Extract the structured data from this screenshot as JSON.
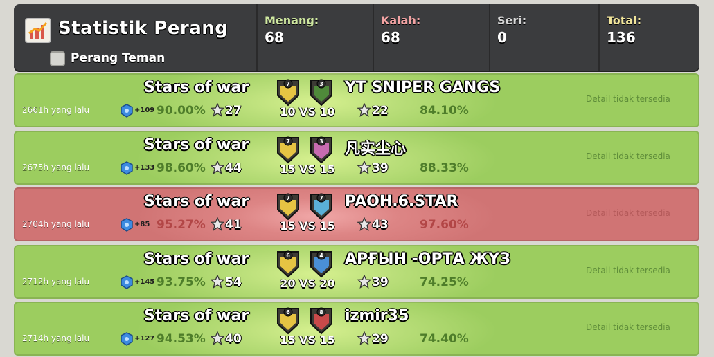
{
  "header": {
    "title": "Statistik Perang",
    "friendly_label": "Perang Teman",
    "stats": [
      {
        "label": "Menang:",
        "value": "68"
      },
      {
        "label": "Kalah:",
        "value": "68"
      },
      {
        "label": "Seri:",
        "value": "0"
      },
      {
        "label": "Total:",
        "value": "136"
      }
    ]
  },
  "colors": {
    "win_row": "#9ccd5f",
    "loss_row": "#d07474",
    "header_bg": "#3b3c3e",
    "win_label": "#cfe8a0",
    "loss_label": "#f2a3a3",
    "total_label": "#f1e59a"
  },
  "wars": [
    {
      "result": "win",
      "ago": "2661h yang lalu",
      "xp": "+109",
      "our_clan": "Stars of war",
      "our_level": "7",
      "our_destruction": "90.00%",
      "our_stars": "27",
      "opp_clan": "YT SNIPER GANGS",
      "opp_level": "3",
      "opp_destruction": "84.10%",
      "opp_stars": "22",
      "size": "10 VS 10",
      "detail": "Detail tidak tersedia"
    },
    {
      "result": "win",
      "ago": "2675h yang lalu",
      "xp": "+133",
      "our_clan": "Stars of war",
      "our_level": "7",
      "our_destruction": "98.60%",
      "our_stars": "44",
      "opp_clan": "凡实尘心",
      "opp_level": "3",
      "opp_destruction": "88.33%",
      "opp_stars": "39",
      "size": "15 VS 15",
      "detail": "Detail tidak tersedia"
    },
    {
      "result": "loss",
      "ago": "2704h yang lalu",
      "xp": "+85",
      "our_clan": "Stars of war",
      "our_level": "7",
      "our_destruction": "95.27%",
      "our_stars": "41",
      "opp_clan": "PAOH.6.STAR",
      "opp_level": "7",
      "opp_destruction": "97.60%",
      "opp_stars": "43",
      "size": "15 VS 15",
      "detail": "Detail tidak tersedia"
    },
    {
      "result": "win",
      "ago": "2712h yang lalu",
      "xp": "+145",
      "our_clan": "Stars of war",
      "our_level": "6",
      "our_destruction": "93.75%",
      "our_stars": "54",
      "opp_clan": "АРҒЫН -ОРТА ЖҮЗ",
      "opp_level": "4",
      "opp_destruction": "74.25%",
      "opp_stars": "39",
      "size": "20 VS 20",
      "detail": "Detail tidak tersedia"
    },
    {
      "result": "win",
      "ago": "2714h yang lalu",
      "xp": "+127",
      "our_clan": "Stars of war",
      "our_level": "6",
      "our_destruction": "94.53%",
      "our_stars": "40",
      "opp_clan": "izmir35",
      "opp_level": "8",
      "opp_destruction": "74.40%",
      "opp_stars": "29",
      "size": "15 VS 15",
      "detail": "Detail tidak tersedia"
    }
  ]
}
